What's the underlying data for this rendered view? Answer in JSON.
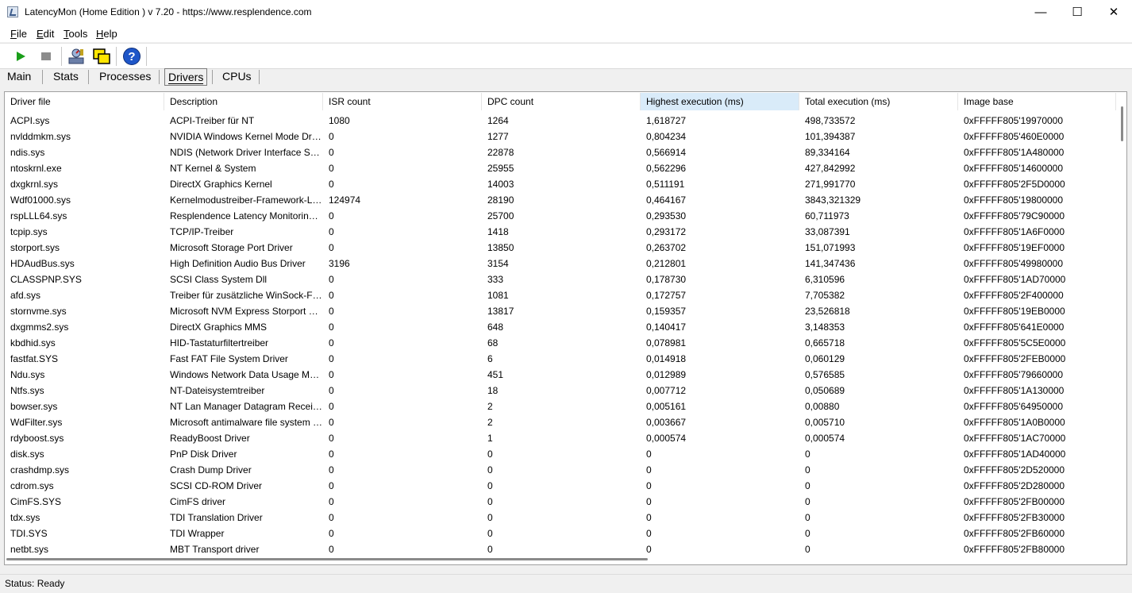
{
  "window": {
    "title": "LatencyMon  (Home Edition )  v 7.20 - https://www.resplendence.com",
    "minimize": "—",
    "maximize": "☐",
    "close": "✕"
  },
  "menu": [
    {
      "label": "File",
      "key": "F",
      "rest": "ile"
    },
    {
      "label": "Edit",
      "key": "E",
      "rest": "dit"
    },
    {
      "label": "Tools",
      "key": "T",
      "rest": "ools"
    },
    {
      "label": "Help",
      "key": "H",
      "rest": "elp"
    }
  ],
  "toolbar": {
    "icons": [
      "play-icon",
      "stop-icon",
      "kernel-icon",
      "windows-icon",
      "help-icon"
    ],
    "colors": {
      "play": "#1a9e1a",
      "stop": "#8c8c8c",
      "help": "#1e56c8"
    }
  },
  "tabs": [
    {
      "label": "Main",
      "active": false
    },
    {
      "label": "Stats",
      "active": false
    },
    {
      "label": "Processes",
      "active": false
    },
    {
      "label": "Drivers",
      "active": true
    },
    {
      "label": "CPUs",
      "active": false
    }
  ],
  "table": {
    "columns": [
      "Driver file",
      "Description",
      "ISR count",
      "DPC count",
      "Highest execution (ms)",
      "Total execution (ms)",
      "Image base"
    ],
    "sorted_column": 4,
    "rows": [
      [
        "ACPI.sys",
        "ACPI-Treiber für NT",
        "1080",
        "1264",
        "1,618727",
        "498,733572",
        "0xFFFFF805'19970000"
      ],
      [
        "nvlddmkm.sys",
        "NVIDIA Windows Kernel Mode Driver",
        "0",
        "1277",
        "0,804234",
        "101,394387",
        "0xFFFFF805'460E0000"
      ],
      [
        "ndis.sys",
        "NDIS (Network Driver Interface Specification)",
        "0",
        "22878",
        "0,566914",
        "89,334164",
        "0xFFFFF805'1A480000"
      ],
      [
        "ntoskrnl.exe",
        "NT Kernel & System",
        "0",
        "25955",
        "0,562296",
        "427,842992",
        "0xFFFFF805'14600000"
      ],
      [
        "dxgkrnl.sys",
        "DirectX Graphics Kernel",
        "0",
        "14003",
        "0,511191",
        "271,991770",
        "0xFFFFF805'2F5D0000"
      ],
      [
        "Wdf01000.sys",
        "Kernelmodustreiber-Framework-Laufzeit",
        "124974",
        "28190",
        "0,464167",
        "3843,321329",
        "0xFFFFF805'19800000"
      ],
      [
        "rspLLL64.sys",
        "Resplendence Latency Monitoring Driver",
        "0",
        "25700",
        "0,293530",
        "60,711973",
        "0xFFFFF805'79C90000"
      ],
      [
        "tcpip.sys",
        "TCP/IP-Treiber",
        "0",
        "1418",
        "0,293172",
        "33,087391",
        "0xFFFFF805'1A6F0000"
      ],
      [
        "storport.sys",
        "Microsoft Storage Port Driver",
        "0",
        "13850",
        "0,263702",
        "151,071993",
        "0xFFFFF805'19EF0000"
      ],
      [
        "HDAudBus.sys",
        "High Definition Audio Bus Driver",
        "3196",
        "3154",
        "0,212801",
        "141,347436",
        "0xFFFFF805'49980000"
      ],
      [
        "CLASSPNP.SYS",
        "SCSI Class System Dll",
        "0",
        "333",
        "0,178730",
        "6,310596",
        "0xFFFFF805'1AD70000"
      ],
      [
        "afd.sys",
        "Treiber für zusätzliche WinSock-Funktionen",
        "0",
        "1081",
        "0,172757",
        "7,705382",
        "0xFFFFF805'2F400000"
      ],
      [
        "stornvme.sys",
        "Microsoft NVM Express Storport Miniport Driver",
        "0",
        "13817",
        "0,159357",
        "23,526818",
        "0xFFFFF805'19EB0000"
      ],
      [
        "dxgmms2.sys",
        "DirectX Graphics MMS",
        "0",
        "648",
        "0,140417",
        "3,148353",
        "0xFFFFF805'641E0000"
      ],
      [
        "kbdhid.sys",
        "HID-Tastaturfiltertreiber",
        "0",
        "68",
        "0,078981",
        "0,665718",
        "0xFFFFF805'5C5E0000"
      ],
      [
        "fastfat.SYS",
        "Fast FAT File System Driver",
        "0",
        "6",
        "0,014918",
        "0,060129",
        "0xFFFFF805'2FEB0000"
      ],
      [
        "Ndu.sys",
        "Windows Network Data Usage Monitoring Driver",
        "0",
        "451",
        "0,012989",
        "0,576585",
        "0xFFFFF805'79660000"
      ],
      [
        "Ntfs.sys",
        "NT-Dateisystemtreiber",
        "0",
        "18",
        "0,007712",
        "0,050689",
        "0xFFFFF805'1A130000"
      ],
      [
        "bowser.sys",
        "NT Lan Manager Datagram Receiver Driver",
        "0",
        "2",
        "0,005161",
        "0,00880",
        "0xFFFFF805'64950000"
      ],
      [
        "WdFilter.sys",
        "Microsoft antimalware file system filter driver",
        "0",
        "2",
        "0,003667",
        "0,005710",
        "0xFFFFF805'1A0B0000"
      ],
      [
        "rdyboost.sys",
        "ReadyBoost Driver",
        "0",
        "1",
        "0,000574",
        "0,000574",
        "0xFFFFF805'1AC70000"
      ],
      [
        "disk.sys",
        "PnP Disk Driver",
        "0",
        "0",
        "0",
        "0",
        "0xFFFFF805'1AD40000"
      ],
      [
        "crashdmp.sys",
        "Crash Dump Driver",
        "0",
        "0",
        "0",
        "0",
        "0xFFFFF805'2D520000"
      ],
      [
        "cdrom.sys",
        "SCSI CD-ROM Driver",
        "0",
        "0",
        "0",
        "0",
        "0xFFFFF805'2D280000"
      ],
      [
        "CimFS.SYS",
        "CimFS driver",
        "0",
        "0",
        "0",
        "0",
        "0xFFFFF805'2FB00000"
      ],
      [
        "tdx.sys",
        "TDI Translation Driver",
        "0",
        "0",
        "0",
        "0",
        "0xFFFFF805'2FB30000"
      ],
      [
        "TDI.SYS",
        "TDI Wrapper",
        "0",
        "0",
        "0",
        "0",
        "0xFFFFF805'2FB60000"
      ],
      [
        "netbt.sys",
        "MBT Transport driver",
        "0",
        "0",
        "0",
        "0",
        "0xFFFFF805'2FB80000"
      ]
    ]
  },
  "status": {
    "text": "Status: Ready"
  }
}
